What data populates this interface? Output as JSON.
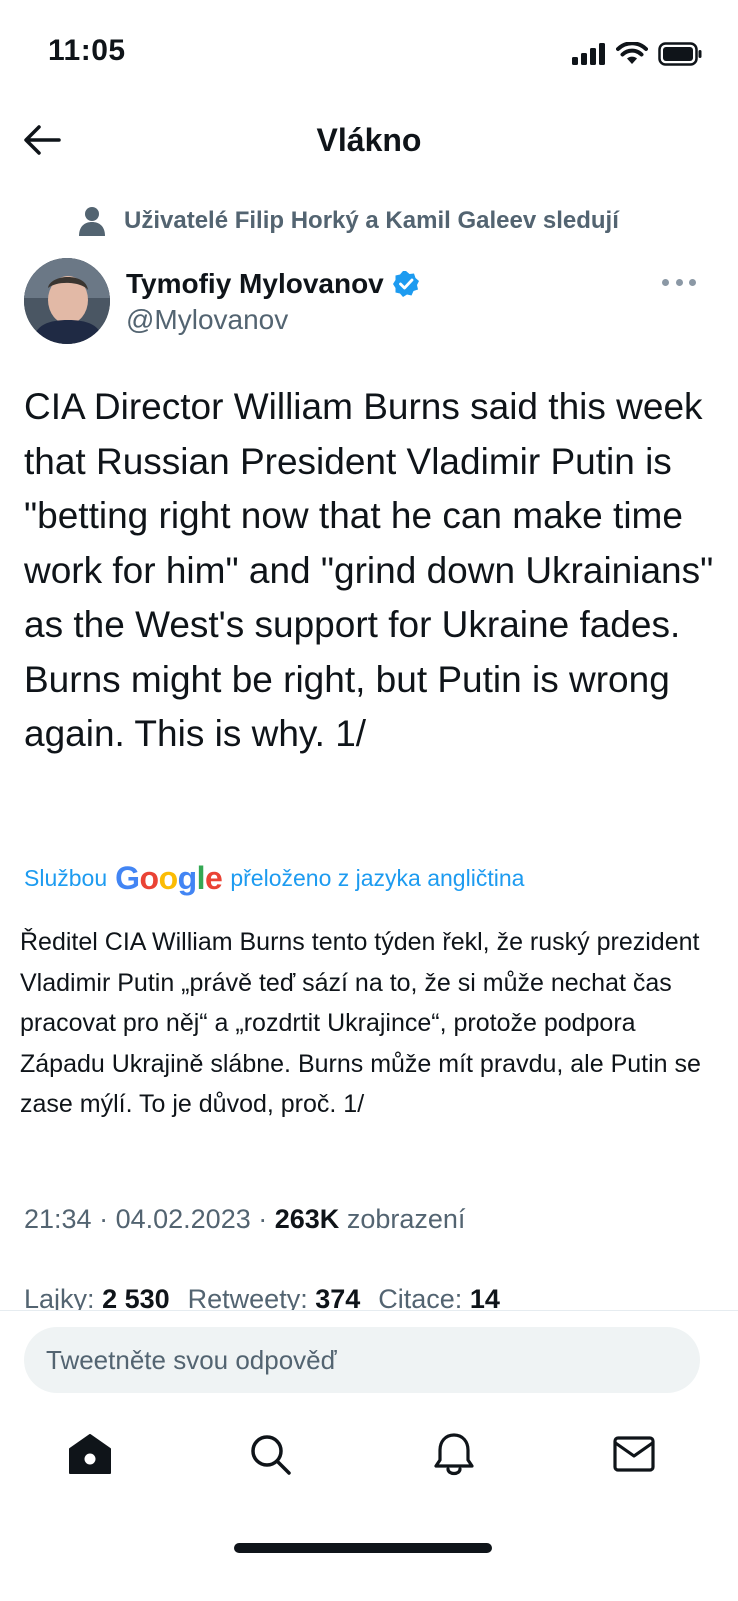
{
  "status_bar": {
    "time": "11:05"
  },
  "header": {
    "title": "Vlákno",
    "back_icon": "arrow-left-icon"
  },
  "social_context": {
    "text": "Uživatelé Filip Horký a Kamil Galeev sledují"
  },
  "author": {
    "name": "Tymofiy Mylovanov",
    "handle": "@Mylovanov",
    "verified": true,
    "verified_color": "#1d9bf0"
  },
  "tweet": {
    "text": "CIA Director William Burns said this week that Russian President Vladimir Putin is \"betting right now that he can make time work for him\" and \"grind down Ukrainians\" as the West's support for Ukraine fades. Burns might be right, but Putin is wrong again.  This is why. 1/",
    "translate": {
      "prefix": "Službou",
      "brand": "Google",
      "suffix": "přeloženo z jazyka angličtina"
    },
    "translated_text": "Ředitel CIA William Burns tento týden řekl, že ruský prezident Vladimir Putin „právě teď sází na to, že si může nechat čas pracovat pro něj“ a „rozdrtit Ukrajince“, protože podpora Západu Ukrajině slábne. Burns může mít pravdu, ale Putin se zase mýlí. To je důvod, proč. 1/",
    "time": "21:34",
    "date": "04.02.2023",
    "views_count": "263K",
    "views_label": "zobrazení",
    "stats": {
      "likes_label": "Lajky:",
      "likes": "2 530",
      "retweets_label": "Retweety:",
      "retweets": "374",
      "quotes_label": "Citace:",
      "quotes": "14"
    }
  },
  "reply": {
    "placeholder": "Tweetněte svou odpověď"
  },
  "bottom_nav": [
    "home-icon",
    "search-icon",
    "notifications-bell-icon",
    "messages-envelope-icon"
  ],
  "colors": {
    "accent": "#1d9bf0",
    "text": "#0f1419",
    "secondary": "#536471"
  }
}
